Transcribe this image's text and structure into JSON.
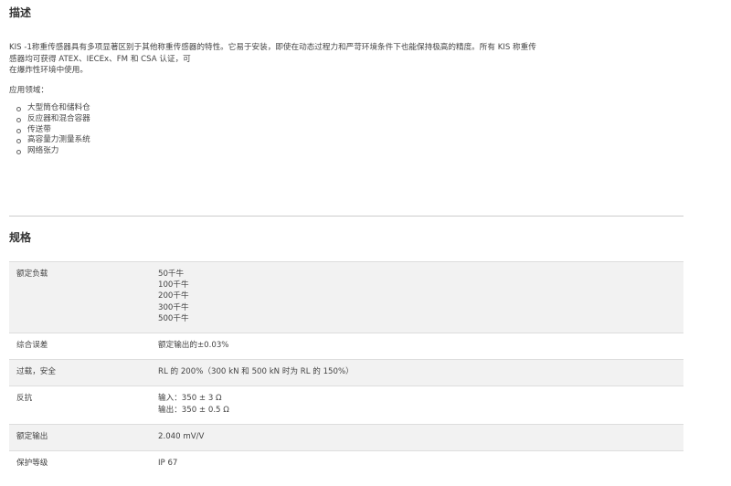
{
  "description": {
    "title": "描述",
    "paragraph_lines": [
      "KIS -1称重传感器具有多项显著区别于其他称重传感器的特性。它易于安装，即使在动态过程力和严苛环境条件下也能保持极高的精度。所有 KIS 称重传",
      "感器均可获得 ATEX、IECEx、FM 和 CSA 认证，可",
      "在爆炸性环境中使用。"
    ],
    "applications_label": "应用领域：",
    "applications": [
      "大型筒仓和储料仓",
      "反应器和混合容器",
      "传送带",
      "高容量力测量系统",
      "网络张力"
    ]
  },
  "specs": {
    "title": "规格",
    "rows": [
      {
        "key": "额定负载",
        "values": [
          "50千牛",
          "100千牛",
          "200千牛",
          "300千牛",
          "500千牛"
        ]
      },
      {
        "key": "综合误差",
        "values": [
          "额定输出的±0.03%"
        ]
      },
      {
        "key": "过载，安全",
        "values": [
          "RL 的 200%（300 kN 和 500 kN 时为 RL 的 150%）"
        ]
      },
      {
        "key": "反抗",
        "values": [
          "输入：350 ± 3 Ω",
          "输出：350 ± 0.5 Ω"
        ]
      },
      {
        "key": "额定输出",
        "values": [
          "2.040 mV/V"
        ]
      },
      {
        "key": "保护等级",
        "values": [
          "IP 67"
        ]
      }
    ]
  }
}
